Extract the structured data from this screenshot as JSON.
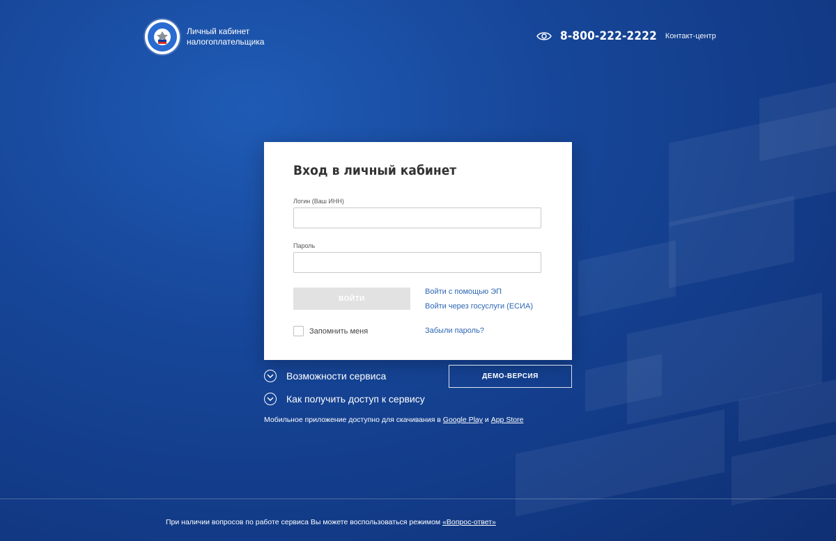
{
  "header": {
    "brand_line1": "Личный кабинет",
    "brand_line2": "налогоплательщика",
    "phone": "8-800-222-2222",
    "contact_center": "Контакт-центр"
  },
  "login": {
    "title": "Вход в личный кабинет",
    "login_label": "Логин (Ваш ИНН)",
    "login_value": "",
    "password_label": "Пароль",
    "password_value": "",
    "submit_label": "ВОЙТИ",
    "link_ep": "Войти с помощью ЭП",
    "link_gosuslugi": "Войти через госуслуги (ЕСИА)",
    "remember_label": "Запомнить меня",
    "forgot_label": "Забыли пароль?"
  },
  "below": {
    "features_label": "Возможности сервиса",
    "access_label": "Как получить доступ к сервису",
    "demo_label": "ДЕМО-ВЕРСИЯ",
    "mobile_prefix": "Мобильное приложение доступно для скачивания в",
    "google_play": "Google Play",
    "mobile_and": "и",
    "app_store": "App Store"
  },
  "footer": {
    "text": "При наличии вопросов по работе сервиса Вы можете воспользоваться режимом",
    "link": "«Вопрос-ответ»"
  },
  "icons": {
    "logo": "fns-emblem-icon",
    "accessibility": "eye-icon",
    "accordion": "chevron-down-icon"
  },
  "colors": {
    "background": "#17479a",
    "link": "#2d66b5",
    "button_disabled": "#e2e2e2"
  }
}
